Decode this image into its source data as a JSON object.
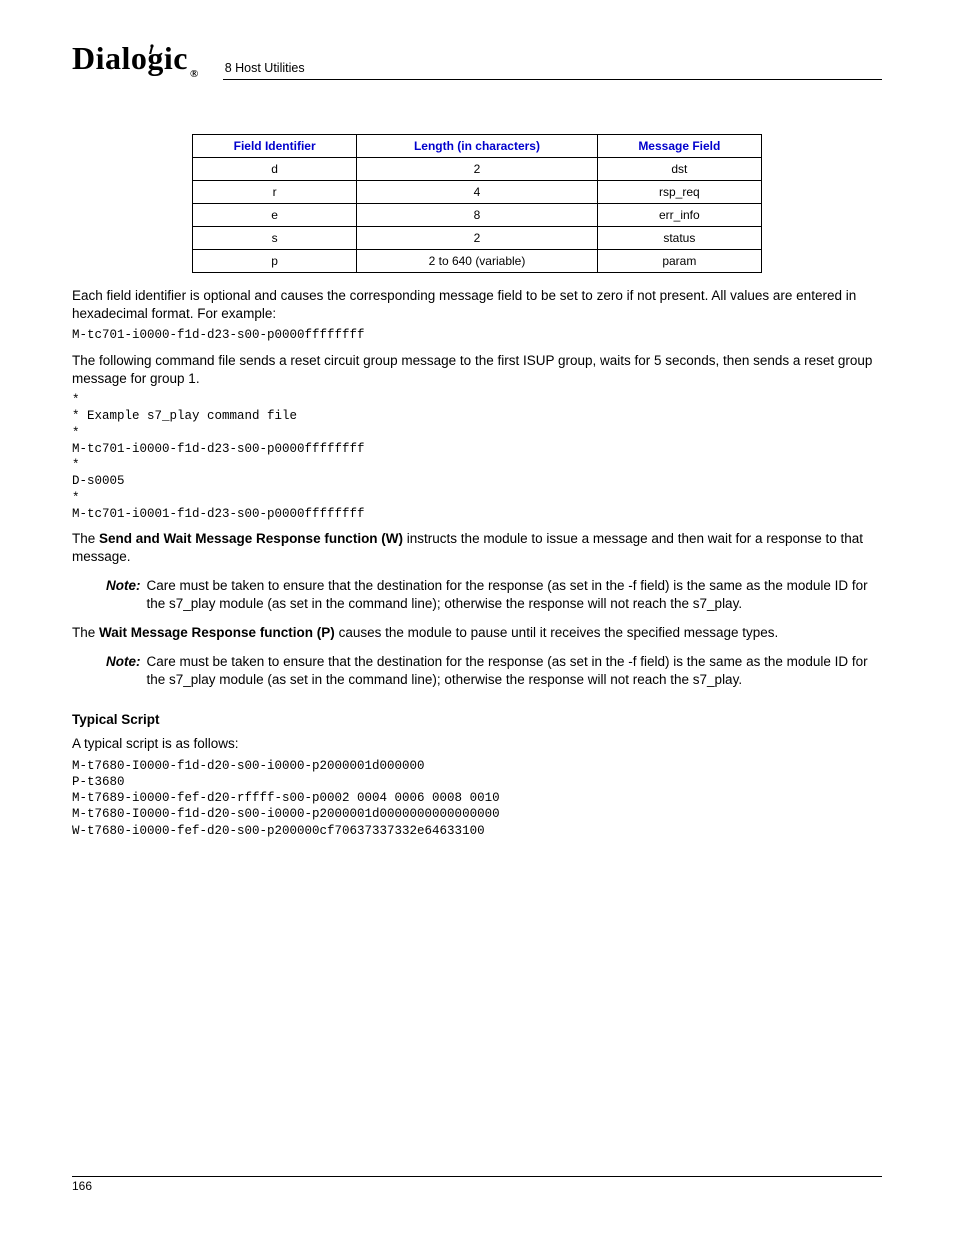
{
  "header": {
    "logo_text": "Dialogic",
    "section_label": "8 Host Utilities"
  },
  "table": {
    "headers": [
      "Field Identifier",
      "Length (in characters)",
      "Message Field"
    ],
    "rows": [
      {
        "id": "d",
        "len": "2",
        "msg": "dst"
      },
      {
        "id": "r",
        "len": "4",
        "msg": "rsp_req"
      },
      {
        "id": "e",
        "len": "8",
        "msg": "err_info"
      },
      {
        "id": "s",
        "len": "2",
        "msg": "status"
      },
      {
        "id": "p",
        "len": "2 to 640 (variable)",
        "msg": "param"
      }
    ]
  },
  "para1": "Each field identifier is optional and causes the corresponding message field to be set to zero if not present. All values are entered in hexadecimal format. For example:",
  "code1": "M-tc701-i0000-f1d-d23-s00-p0000ffffffff",
  "para2": "The following command file sends a reset circuit group message to the first ISUP group, waits for 5 seconds, then sends a reset group message for group 1.",
  "code2": "*\n* Example s7_play command file\n*\nM-tc701-i0000-f1d-d23-s00-p0000ffffffff\n*\nD-s0005\n*\nM-tc701-i0001-f1d-d23-s00-p0000ffffffff",
  "para3_pre": "The ",
  "para3_bold": "Send and Wait Message Response function (W)",
  "para3_post": " instructs the module to issue a message and then wait for a response to that message.",
  "note_label": "Note:",
  "note1": "Care must be taken to ensure that the destination for the response (as set in the -f field) is the same as the module ID for the s7_play module (as set in the command line); otherwise the response will not reach the s7_play.",
  "para4_pre": "The ",
  "para4_bold": "Wait Message Response function (P)",
  "para4_post": " causes the module to pause until it receives the specified message types.",
  "note2": "Care must be taken to ensure that the destination for the response (as set in the -f field) is the same as the module ID for the s7_play module (as set in the command line); otherwise the response will not reach the s7_play.",
  "typical_heading": "Typical Script",
  "typical_intro": "A typical script is as follows:",
  "code3": "M-t7680-I0000-f1d-d20-s00-i0000-p2000001d000000\nP-t3680\nM-t7689-i0000-fef-d20-rffff-s00-p0002 0004 0006 0008 0010\nM-t7680-I0000-f1d-d20-s00-i0000-p2000001d0000000000000000\nW-t7680-i0000-fef-d20-s00-p200000cf70637337332e64633100",
  "page_number": "166"
}
